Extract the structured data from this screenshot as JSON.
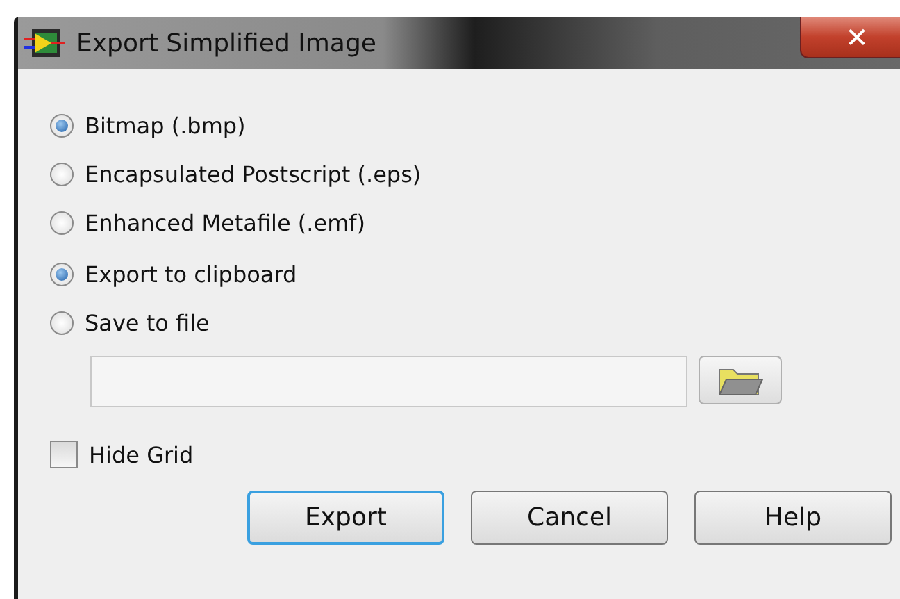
{
  "window": {
    "title": "Export Simplified Image"
  },
  "format_options": [
    {
      "label": "Bitmap (.bmp)",
      "selected": true
    },
    {
      "label": "Encapsulated Postscript (.eps)",
      "selected": false
    },
    {
      "label": "Enhanced Metafile (.emf)",
      "selected": false
    }
  ],
  "destination_options": [
    {
      "label": "Export to clipboard",
      "selected": true
    },
    {
      "label": "Save to file",
      "selected": false
    }
  ],
  "close_glyph": "✕",
  "hide_grid": {
    "label": "Hide Grid",
    "checked": false
  },
  "buttons": [
    {
      "label": "Export",
      "default": true
    },
    {
      "label": "Cancel",
      "default": false
    },
    {
      "label": "Help",
      "default": false
    }
  ]
}
